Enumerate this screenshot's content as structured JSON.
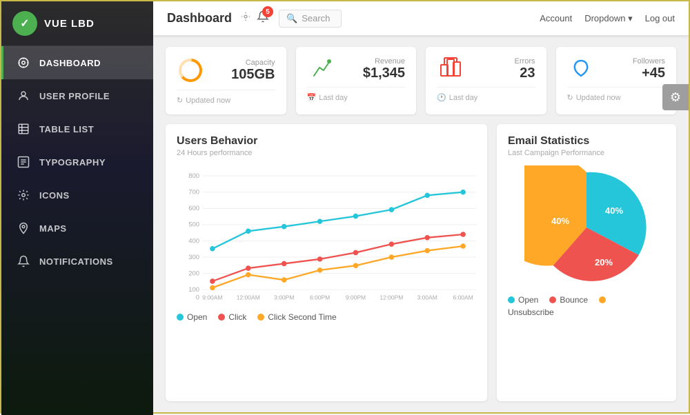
{
  "sidebar": {
    "logo": {
      "icon": "✓",
      "text": "VUE LBD"
    },
    "items": [
      {
        "id": "dashboard",
        "label": "DASHBOARD",
        "icon": "⊙",
        "active": true
      },
      {
        "id": "user-profile",
        "label": "USER PROFILE",
        "icon": "👤",
        "active": false
      },
      {
        "id": "table-list",
        "label": "TABLE LIST",
        "icon": "☰",
        "active": false
      },
      {
        "id": "typography",
        "label": "TYPOGRAPHY",
        "icon": "▦",
        "active": false
      },
      {
        "id": "icons",
        "label": "ICONS",
        "icon": "✳",
        "active": false
      },
      {
        "id": "maps",
        "label": "MAPS",
        "icon": "◎",
        "active": false
      },
      {
        "id": "notifications",
        "label": "NOTIFICATIONS",
        "icon": "🔔",
        "active": false
      }
    ]
  },
  "topbar": {
    "title": "Dashboard",
    "notification_count": "5",
    "search_placeholder": "Search",
    "nav_items": [
      {
        "id": "account",
        "label": "Account"
      },
      {
        "id": "dropdown",
        "label": "Dropdown ▾"
      },
      {
        "id": "logout",
        "label": "Log out"
      }
    ]
  },
  "stats": [
    {
      "id": "capacity",
      "label": "Capacity",
      "value": "105GB",
      "footer": "Updated now",
      "icon": "capacity",
      "color": "#ff9800"
    },
    {
      "id": "revenue",
      "label": "Revenue",
      "value": "$1,345",
      "footer": "Last day",
      "icon": "revenue",
      "color": "#4caf50"
    },
    {
      "id": "errors",
      "label": "Errors",
      "value": "23",
      "footer": "Last day",
      "icon": "errors",
      "color": "#f44336"
    },
    {
      "id": "followers",
      "label": "Followers",
      "value": "+45",
      "footer": "Updated now",
      "icon": "followers",
      "color": "#2196f3"
    }
  ],
  "users_behavior": {
    "title": "Users Behavior",
    "subtitle": "24 Hours performance",
    "y_labels": [
      "800",
      "700",
      "600",
      "500",
      "400",
      "300",
      "200",
      "100",
      "0"
    ],
    "x_labels": [
      "9:00AM",
      "12:00AM",
      "3:00PM",
      "6:00PM",
      "9:00PM",
      "12:00PM",
      "3:00AM",
      "6:00AM"
    ],
    "legend": [
      {
        "id": "open",
        "label": "Open",
        "color": "#26c6da"
      },
      {
        "id": "click",
        "label": "Click",
        "color": "#ef5350"
      },
      {
        "id": "click2",
        "label": "Click Second Time",
        "color": "#ffa726"
      }
    ]
  },
  "email_statistics": {
    "title": "Email Statistics",
    "subtitle": "Last Campaign Performance",
    "segments": [
      {
        "id": "open",
        "label": "Open",
        "value": 40,
        "color": "#26c6da"
      },
      {
        "id": "bounce",
        "label": "Bounce",
        "value": 20,
        "color": "#ef5350"
      },
      {
        "id": "unsubscribe",
        "label": "Unsubscribe",
        "value": 40,
        "color": "#ffa726"
      }
    ],
    "legend": [
      {
        "id": "open",
        "label": "Open",
        "color": "#26c6da"
      },
      {
        "id": "bounce",
        "label": "Bounce",
        "color": "#ef5350"
      },
      {
        "id": "unsubscribe-dot",
        "label": "",
        "color": "#ffa726"
      }
    ]
  },
  "settings": {
    "icon": "⚙"
  }
}
